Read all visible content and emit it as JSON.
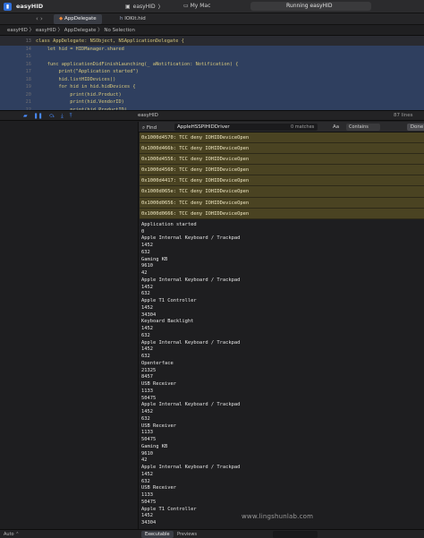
{
  "titlebar": {
    "app_name": "easyHID",
    "scheme": "easyHID",
    "destination": "My Mac",
    "status": "Running easyHID"
  },
  "tabs": [
    {
      "label": "AppDelegate",
      "active": true
    },
    {
      "label": "IOKit.hid",
      "active": false
    }
  ],
  "jumpbar": {
    "path": "easyHID 〉 easyHID 〉 AppDelegate 〉 No Selection"
  },
  "code_lines": [
    {
      "ln": "13",
      "text": "class AppDelegate: NSObject, NSApplicationDelegate {"
    },
    {
      "ln": "14",
      "text": "    let hid = HIDManager.shared"
    },
    {
      "ln": "15",
      "text": ""
    },
    {
      "ln": "16",
      "text": "    func applicationDidFinishLaunching(_ aNotification: Notification) {"
    },
    {
      "ln": "17",
      "text": "        print(\"Application started\")"
    },
    {
      "ln": "18",
      "text": "        hid.listHIDDevices()"
    },
    {
      "ln": "19",
      "text": "        for hid in hid.hidDevices {"
    },
    {
      "ln": "20",
      "text": "            print(hid.Product)"
    },
    {
      "ln": "21",
      "text": "            print(hid.VendorID)"
    },
    {
      "ln": "22",
      "text": "            print(hid.ProductID)"
    }
  ],
  "debugbar": {
    "target": "easyHID",
    "lines": "87 lines"
  },
  "find": {
    "mode": "Find",
    "query": "AppleHSSPIHIDDriver",
    "matches": "0 matches",
    "case_label": "Aa",
    "contains": "Contains",
    "done": "Done"
  },
  "console_highlighted": [
    "0x1000d4570: TCC deny IOHIDDeviceOpen",
    "0x1000d466b: TCC deny IOHIDDeviceOpen",
    "0x1000d4556: TCC deny IOHIDDeviceOpen",
    "0x1000d4560: TCC deny IOHIDDeviceOpen",
    "0x1000d4417: TCC deny IOHIDDeviceOpen",
    "0x1000d065e: TCC deny IOHIDDeviceOpen",
    "0x1000d0656: TCC deny IOHIDDeviceOpen",
    "0x1000d0666: TCC deny IOHIDDeviceOpen"
  ],
  "console_lines": [
    "Application started",
    "0",
    "Apple Internal Keyboard / Trackpad",
    "1452",
    "632",
    "Gaming KB",
    "9610",
    "42",
    "Apple Internal Keyboard / Trackpad",
    "1452",
    "632",
    "Apple T1 Controller",
    "1452",
    "34304",
    "Keyboard Backlight",
    "1452",
    "632",
    "Apple Internal Keyboard / Trackpad",
    "1452",
    "632",
    "Openterface",
    "21325",
    "8457",
    "USB Receiver",
    "1133",
    "50475",
    "Apple Internal Keyboard / Trackpad",
    "1452",
    "632",
    "USB Receiver",
    "1133",
    "50475",
    "Gaming KB",
    "9610",
    "42",
    "Apple Internal Keyboard / Trackpad",
    "1452",
    "632",
    "USB Receiver",
    "1133",
    "50475",
    "Apple T1 Controller",
    "1452",
    "34304"
  ],
  "watermark": "www.lingshunlab.com",
  "statusbar": {
    "auto": "Auto ⌃",
    "executable": "Executable",
    "previews": "Previews"
  }
}
